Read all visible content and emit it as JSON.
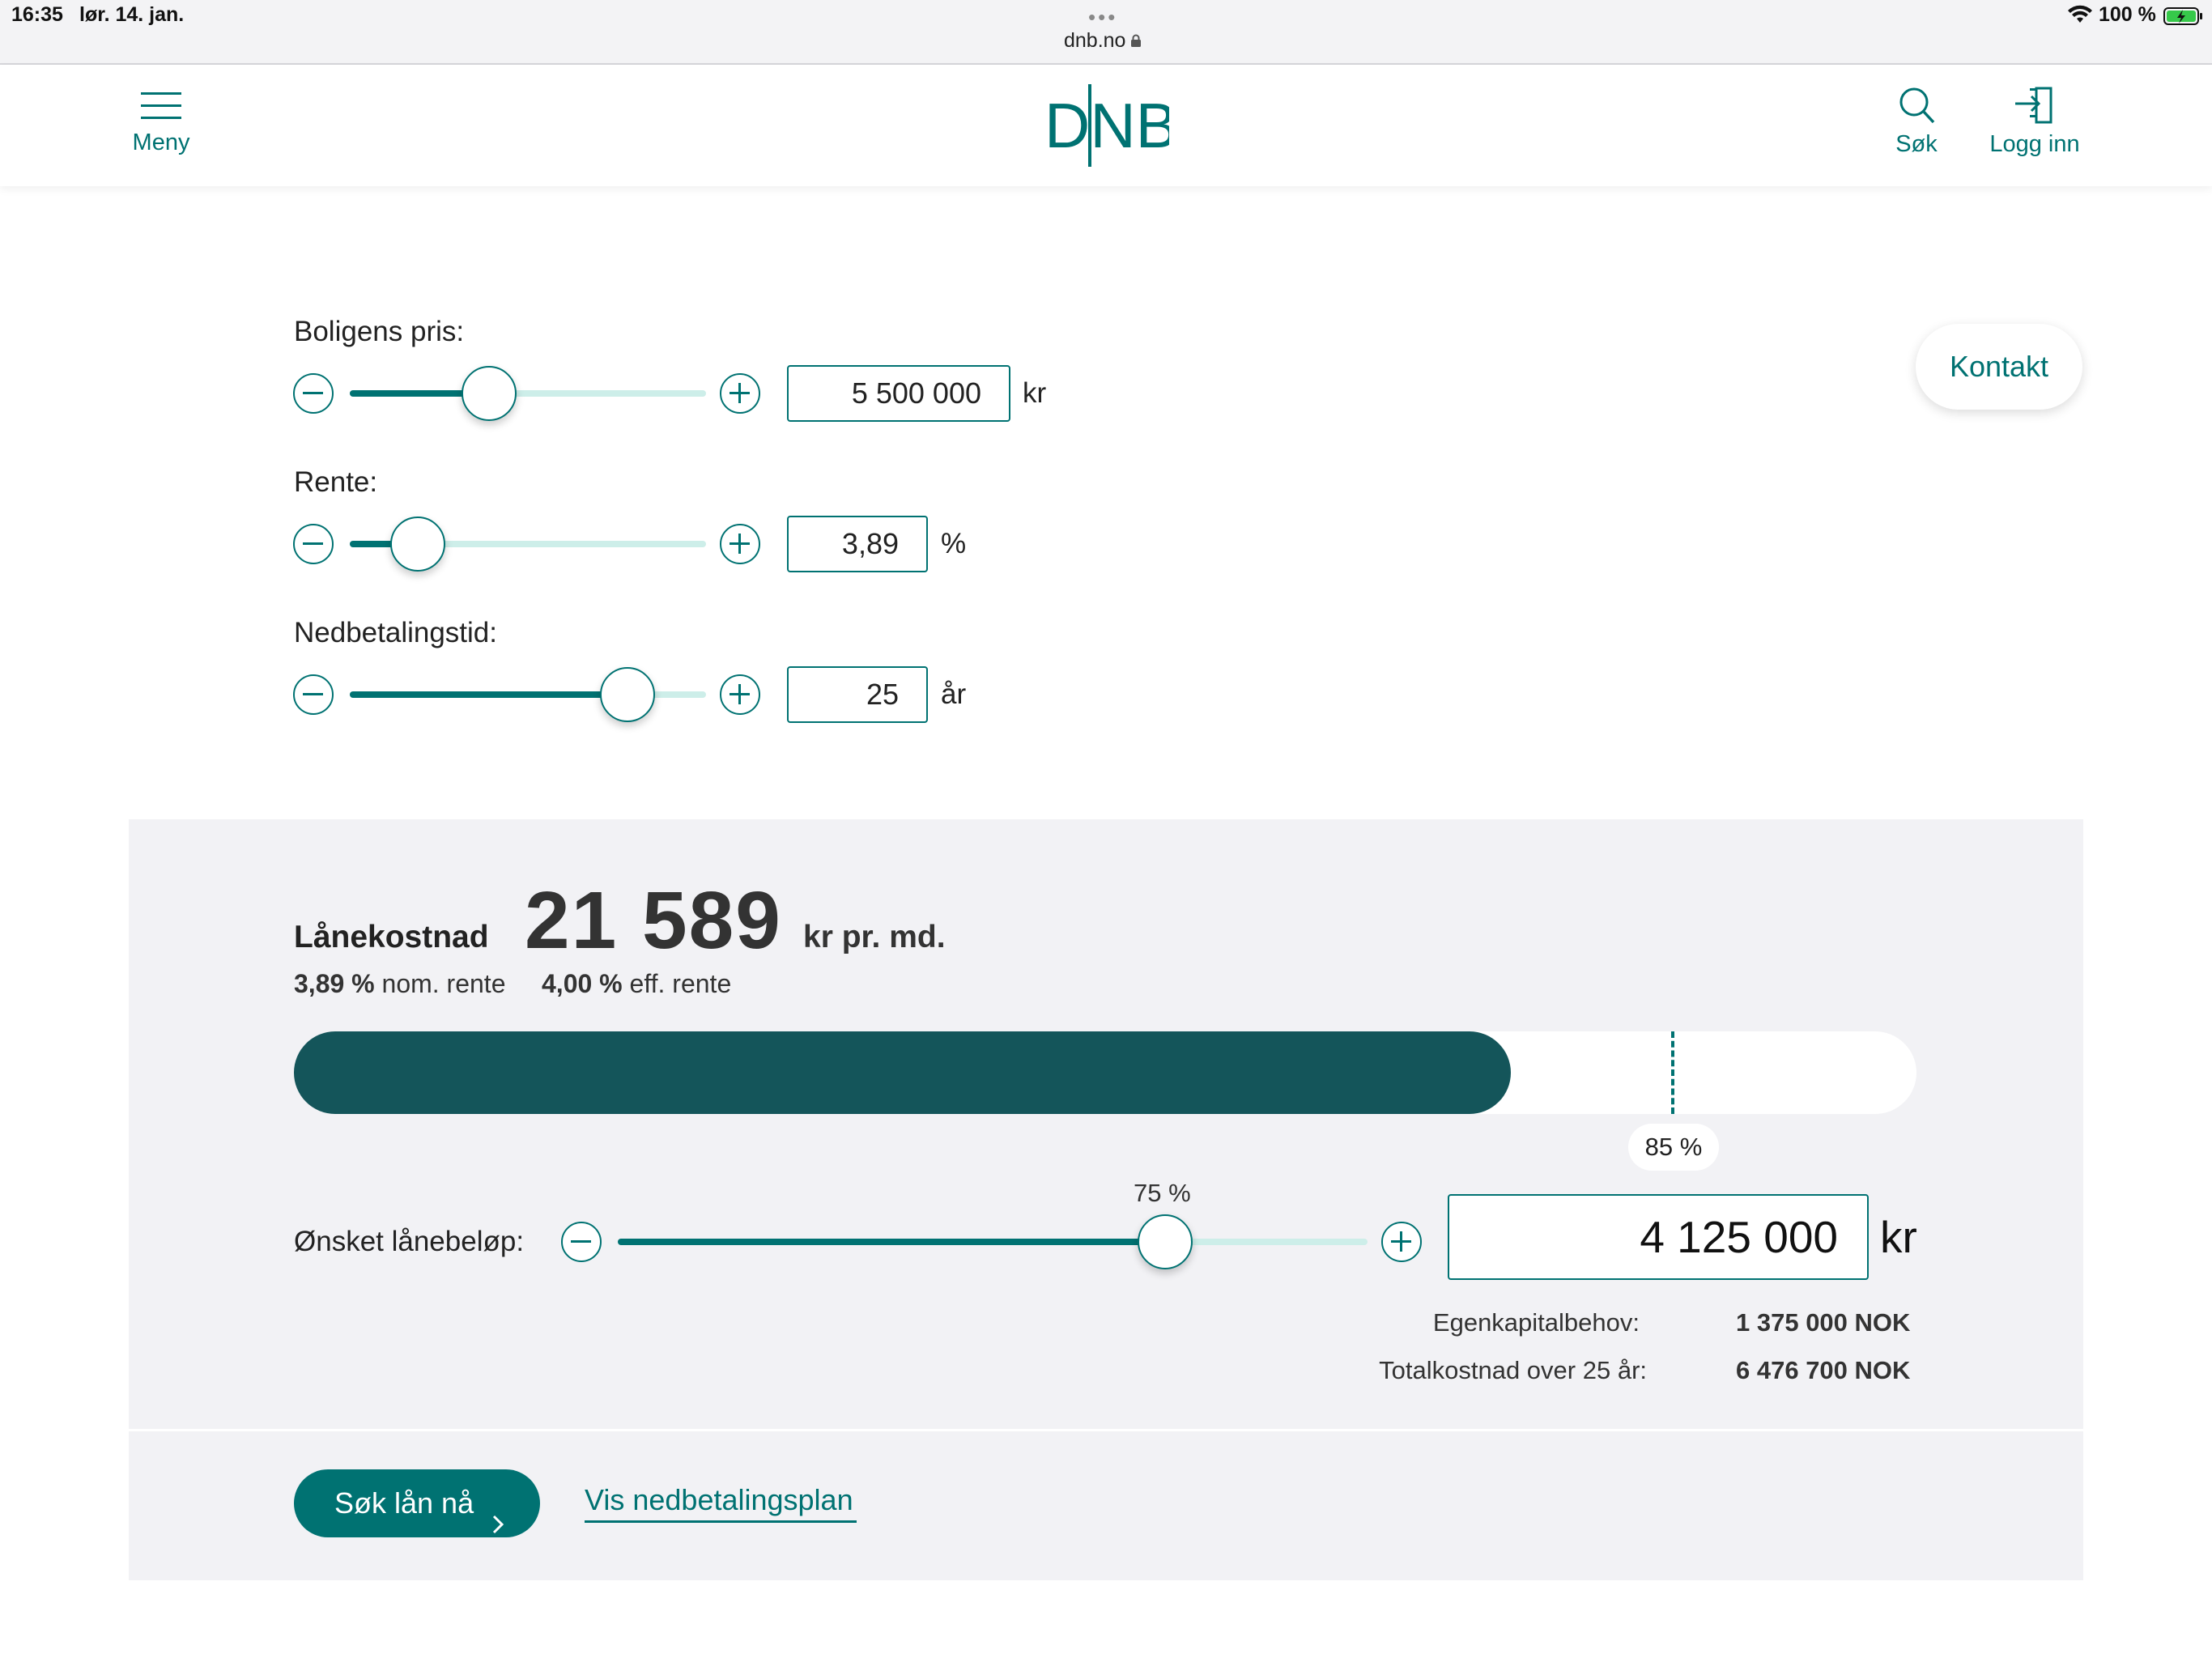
{
  "status_bar": {
    "time": "16:35",
    "date": "lør. 14. jan.",
    "url": "dnb.no",
    "battery": "100 %"
  },
  "header": {
    "menu_label": "Meny",
    "logo_text": "DNB",
    "search_label": "Søk",
    "login_label": "Logg inn",
    "brand_color": "#007272"
  },
  "calculator": {
    "price": {
      "label": "Boligens pris:",
      "value": "5 500 000",
      "unit": "kr",
      "slider_level": 0.39
    },
    "rate": {
      "label": "Rente:",
      "value": "3,89",
      "unit": "%",
      "slider_level": 0.19
    },
    "term": {
      "label": "Nedbetalingstid:",
      "value": "25",
      "unit": "år",
      "slider_level": 0.78
    }
  },
  "contact_button": "Kontakt",
  "results": {
    "cost_label": "Lånekostnad",
    "monthly_cost": "21 589",
    "monthly_unit": "kr pr. md.",
    "nominal_rate_value": "3,89 %",
    "nominal_rate_label": "nom. rente",
    "effective_rate_value": "4,00 %",
    "effective_rate_label": "eff. rente",
    "loan_ratio_fill": 0.75,
    "max_ratio_label": "85 %",
    "max_ratio": 0.85,
    "loan_label": "Ønsket lånebeløp:",
    "loan_pct_label": "75 %",
    "loan_slider_level": 0.73,
    "loan_amount": "4 125 000",
    "loan_unit": "kr",
    "equity_label": "Egenkapitalbehov:",
    "equity_value": "1 375 000 NOK",
    "total_label": "Totalkostnad over 25 år:",
    "total_value": "6 476 700 NOK",
    "bar_color": "#14555a"
  },
  "actions": {
    "apply_label": "Søk lån nå",
    "plan_link": "Vis nedbetalingsplan"
  }
}
